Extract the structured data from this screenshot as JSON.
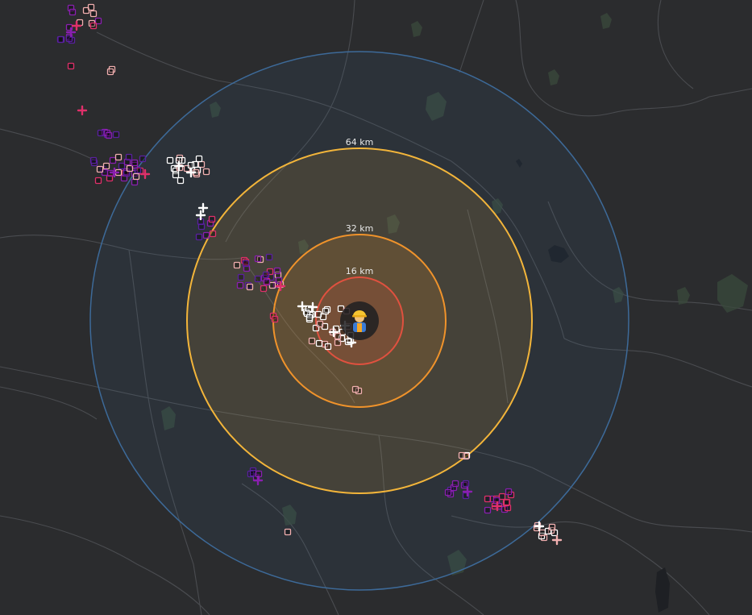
{
  "map": {
    "background": "#2b2c2e",
    "colors": {
      "ring_64": "#f3b53a",
      "ring_32": "#f0932b",
      "ring_16": "#e0513f",
      "ring_outer": "#3d6a99",
      "road": "#4a4c50",
      "vegetation": "#3a4a3c",
      "water": "#1e2024",
      "cg_pos": "#ffffff",
      "cg_neg": "#ffffff",
      "ic_low": "#f2b0b0",
      "ic_mid": "#e0306a",
      "ic_high": "#8a1fb0",
      "ic_old": "#5a20a0"
    },
    "user_icon": "construction-worker-icon",
    "rings": [
      {
        "label": "16 km"
      },
      {
        "label": "32 km"
      },
      {
        "label": "64 km"
      },
      {
        "label": ""
      }
    ]
  }
}
